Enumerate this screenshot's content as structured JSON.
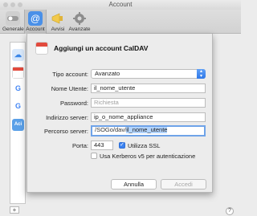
{
  "window": {
    "title": "Account"
  },
  "toolbar": {
    "items": [
      {
        "label": "Generale"
      },
      {
        "label": "Account"
      },
      {
        "label": "Avvisi"
      },
      {
        "label": "Avanzate"
      }
    ]
  },
  "sidebar": {
    "add_label": "+"
  },
  "dialog": {
    "title": "Aggiungi un account CalDAV",
    "tipo_account": {
      "label": "Tipo account:",
      "value": "Avanzato"
    },
    "nome_utente": {
      "label": "Nome Utente:",
      "value": "il_nome_utente"
    },
    "password": {
      "label": "Password:",
      "placeholder": "Richiesta"
    },
    "indirizzo_server": {
      "label": "Indirizzo server:",
      "value": "ip_o_nome_appliance"
    },
    "percorso_server": {
      "label": "Percorso server:",
      "prefix": "/SOGo/dav/",
      "selected": "il_nome_utente"
    },
    "porta": {
      "label": "Porta:",
      "value": "443"
    },
    "ssl": {
      "label": "Utilizza SSL",
      "checked": true
    },
    "kerberos": {
      "label": "Usa Kerberos v5 per autenticazione",
      "checked": false
    },
    "cancel_label": "Annulla",
    "accept_label": "Accedi"
  },
  "help_label": "?",
  "colors": {
    "accent": "#3b82f0",
    "calendar_red": "#e24a3d"
  }
}
